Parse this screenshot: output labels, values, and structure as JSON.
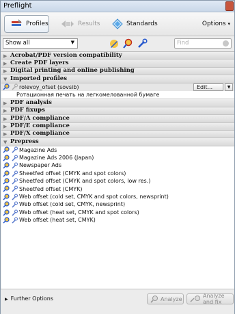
{
  "window": {
    "title": "Preflight"
  },
  "tabs": [
    {
      "label": "Profiles",
      "icon": "profiles-icon",
      "state": "active"
    },
    {
      "label": "Results",
      "icon": "results-icon",
      "state": "disabled"
    },
    {
      "label": "Standards",
      "icon": "standards-icon",
      "state": "normal"
    }
  ],
  "toolbar": {
    "options_label": "Options"
  },
  "filter": {
    "show_value": "Show all",
    "search_placeholder": "Find"
  },
  "categories_top": [
    "Acrobat/PDF version compatibility",
    "Create PDF layers",
    "Digital printing and online publishing"
  ],
  "imported": {
    "label": "Imported profiles",
    "profile": "rolevoy_ofset (sovsib)",
    "edit_label": "Edit...",
    "description": "Ротационная печать на легкомелованной бумаге"
  },
  "categories_mid": [
    "PDF analysis",
    "PDF fixups",
    "PDF/A compliance",
    "PDF/E compliance",
    "PDF/X compliance"
  ],
  "prepress": {
    "label": "Prepress",
    "items": [
      "Magazine Ads",
      "Magazine Ads 2006 (Japan)",
      "Newspaper Ads",
      "Sheetfed offset (CMYK and spot colors)",
      "Sheetfed offset (CMYK and spot colors, low res.)",
      "Sheetfed offset (CMYK)",
      "Web offset (cold set, CMYK and spot colors, newsprint)",
      "Web offset (cold set, CMYK, newsprint)",
      "Web offset (heat set, CMYK and spot colors)",
      "Web offset (heat set, CMYK)"
    ]
  },
  "footer": {
    "further_label": "Further Options",
    "analyze_label": "Analyze",
    "analyze_fix_label": "Analyze and fix"
  },
  "colors": {
    "accent": "#2a5db0",
    "icon_blue": "#2255cc",
    "icon_gold": "#f0b020"
  }
}
